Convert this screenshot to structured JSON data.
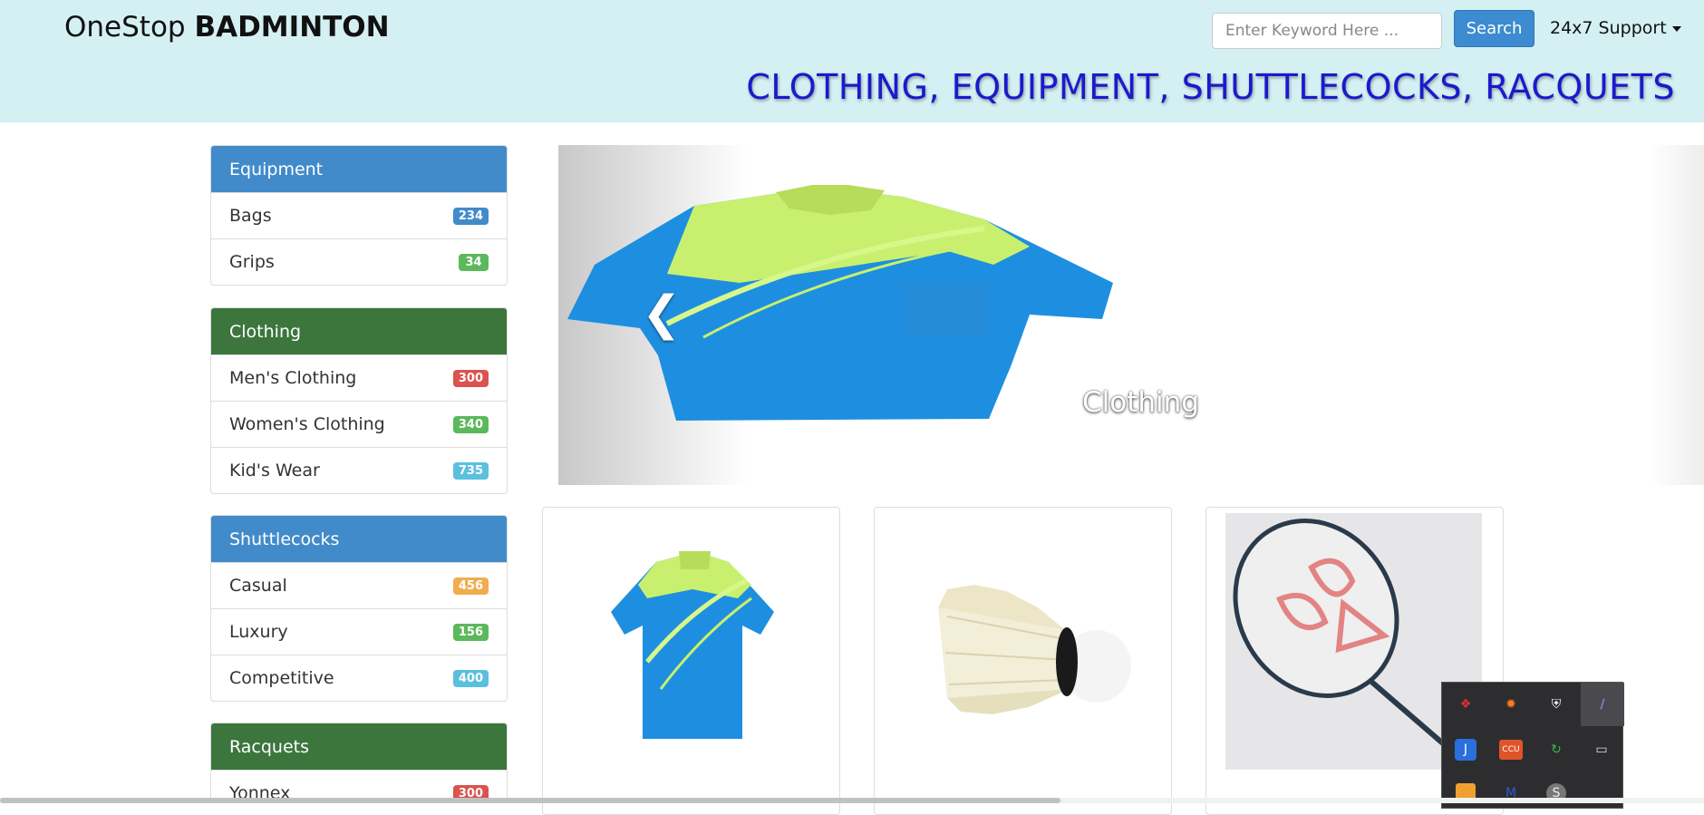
{
  "header": {
    "brand_light": "OneStop ",
    "brand_bold": "BADMINTON",
    "search_placeholder": "Enter Keyword Here ...",
    "search_label": "Search",
    "support_label": "24x7 Support",
    "tagline": "CLOTHING, EQUIPMENT, SHUTTLECOCKS, RACQUETS"
  },
  "sidebar": {
    "equipment": {
      "title": "Equipment",
      "color": "#428bca",
      "items": [
        {
          "label": "Bags",
          "count": "234",
          "badge_color": "#428bca"
        },
        {
          "label": "Grips",
          "count": "34",
          "badge_color": "#5cb85c"
        }
      ]
    },
    "clothing": {
      "title": "Clothing",
      "color": "#3c763d",
      "items": [
        {
          "label": "Men's Clothing",
          "count": "300",
          "badge_color": "#d9534f"
        },
        {
          "label": "Women's Clothing",
          "count": "340",
          "badge_color": "#5cb85c"
        },
        {
          "label": "Kid's Wear",
          "count": "735",
          "badge_color": "#5bc0de"
        }
      ]
    },
    "shuttlecocks": {
      "title": "Shuttlecocks",
      "color": "#428bca",
      "items": [
        {
          "label": "Casual",
          "count": "456",
          "badge_color": "#f0ad4e"
        },
        {
          "label": "Luxury",
          "count": "156",
          "badge_color": "#5cb85c"
        },
        {
          "label": "Competitive",
          "count": "400",
          "badge_color": "#5bc0de"
        }
      ]
    },
    "racquets": {
      "title": "Racquets",
      "color": "#3c763d",
      "items": [
        {
          "label": "Yonnex",
          "count": "300",
          "badge_color": "#d9534f"
        }
      ]
    }
  },
  "carousel": {
    "caption": "Clothing",
    "prev_icon": "chevron-left-icon"
  },
  "products": [
    {
      "name": "badminton-shirt",
      "icon": "shirt-image"
    },
    {
      "name": "shuttlecock",
      "icon": "shuttlecock-image"
    },
    {
      "name": "yonex-racquet",
      "icon": "racquet-image"
    }
  ],
  "tray": {
    "icons": [
      "app-red-icon",
      "avast-icon",
      "defender-shield-icon",
      "feather-icon",
      "j-app-icon",
      "ccu-icon",
      "green-sync-icon",
      "display-icon",
      "orange-app-icon",
      "mcafee-icon",
      "s-circle-icon"
    ]
  }
}
